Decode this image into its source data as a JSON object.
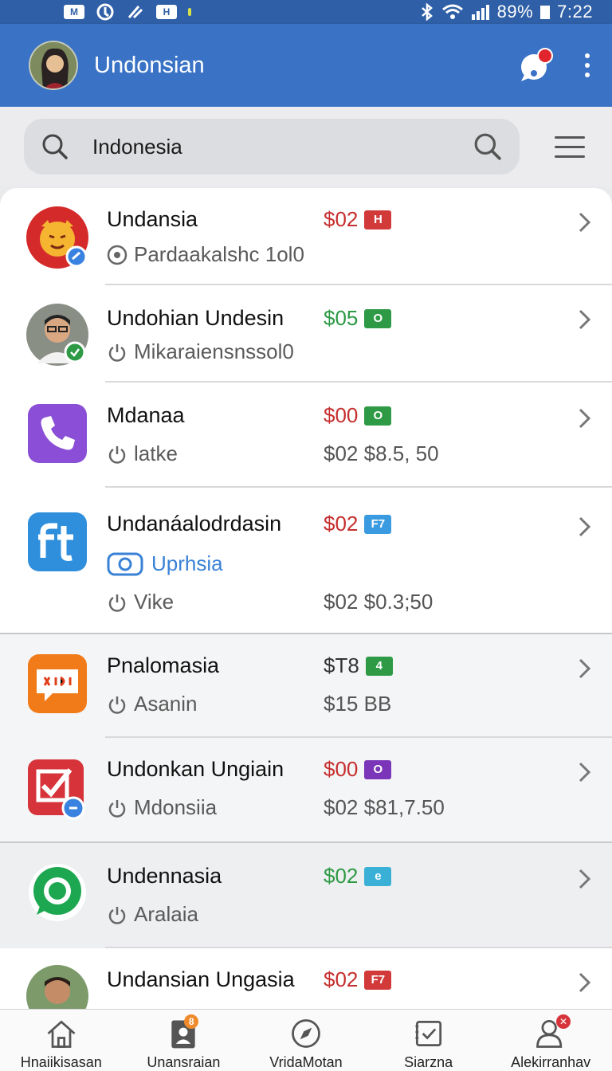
{
  "status_bar": {
    "battery": "89%",
    "time": "7:22",
    "chip1": "M",
    "chip2": "H"
  },
  "app_bar": {
    "title": "Undonsian"
  },
  "search": {
    "value": "Indonesia"
  },
  "colors": {
    "app_bar": "#3a73c6",
    "status_bar": "#2f5fa6",
    "price_red": "#c62f2f",
    "price_green": "#2e9a45",
    "link_blue": "#3a82d6"
  },
  "rows": [
    {
      "name": "Undansia",
      "price": "$02",
      "tag": "H",
      "tag_color": "#d23a3a",
      "price_color": "red",
      "sub": "Pardaakalshc 1ol0",
      "sub_icon": "radio-icon",
      "amount": "",
      "icon": "lion-app-icon"
    },
    {
      "name": "Undohian Undesin",
      "price": "$05",
      "tag": "O",
      "tag_color": "#2e9a45",
      "price_color": "green",
      "sub": "Mikaraiensnssol0",
      "sub_icon": "power-icon",
      "amount": "",
      "icon": "man-avatar-icon"
    },
    {
      "name": "Mdanaa",
      "price": "$00",
      "tag": "O",
      "tag_color": "#2e9a45",
      "price_color": "red",
      "sub": "latke",
      "sub_icon": "power-icon",
      "amount": "$02 $8.5, 50",
      "icon": "phone-app-icon"
    },
    {
      "name": "Undanáalodrdasin",
      "price": "$02",
      "tag": "F7",
      "tag_color": "#3a9be0",
      "price_color": "red",
      "pill": "Uprhsia",
      "sub": "Vike",
      "sub_icon": "power-icon",
      "amount": "$02 $0.3;50",
      "icon": "ft-app-icon"
    },
    {
      "name": "Pnalomasia",
      "price": "$T8",
      "tag": "4",
      "tag_color": "#2e9a45",
      "price_color": "dark",
      "sub": "Asanin",
      "sub_icon": "power-icon",
      "amount": "$15 BB",
      "icon": "chat-bubble-app-icon"
    },
    {
      "name": "Undonkan Ungiain",
      "price": "$00",
      "tag": "O",
      "tag_color": "#7a35b8",
      "price_color": "red",
      "sub": "Mdonsiia",
      "sub_icon": "power-icon",
      "amount": "$02 $81,7.50",
      "icon": "checkbox-app-icon"
    },
    {
      "name": "Undennasia",
      "price": "$02",
      "tag": "e",
      "tag_color": "#3ab0d6",
      "price_color": "green",
      "sub": "Aralaia",
      "sub_icon": "power-icon",
      "amount": "",
      "icon": "whatsapp-app-icon"
    },
    {
      "name": "Undansian Ungasia",
      "price": "$02",
      "tag": "F7",
      "tag_color": "#d23a3a",
      "price_color": "red",
      "sub": "",
      "sub_icon": "",
      "amount": "",
      "icon": "man-avatar-icon"
    }
  ],
  "bottom_nav": [
    {
      "label": "Hnaiikisasan",
      "icon": "home-icon"
    },
    {
      "label": "Unansraian",
      "icon": "contacts-icon",
      "badge": "8"
    },
    {
      "label": "VridaMotan",
      "icon": "compass-icon"
    },
    {
      "label": "Siarzna",
      "icon": "checklist-icon"
    },
    {
      "label": "Alekirranhav",
      "icon": "profile-icon",
      "badge": ""
    }
  ]
}
